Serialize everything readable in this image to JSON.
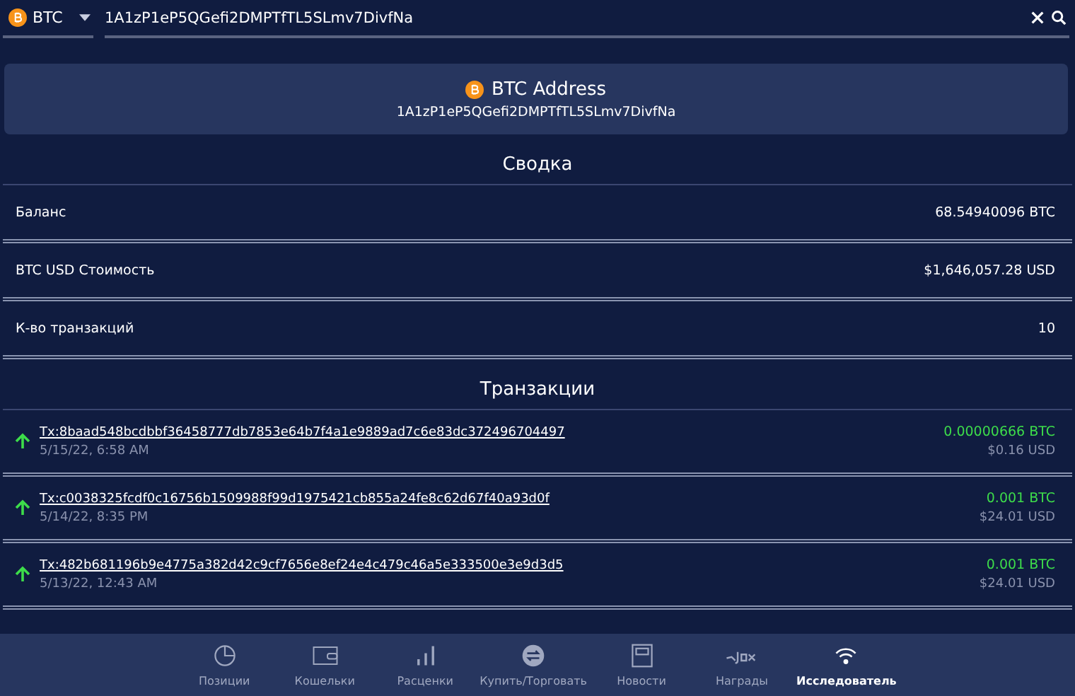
{
  "coin_selector": {
    "symbol": "BTC"
  },
  "search": {
    "value": "1A1zP1eP5QGefi2DMPTfTL5SLmv7DivfNa"
  },
  "address_card": {
    "title": "BTC Address",
    "address": "1A1zP1eP5QGefi2DMPTfTL5SLmv7DivfNa"
  },
  "summary": {
    "title": "Сводка",
    "rows": [
      {
        "label": "Баланс",
        "value": "68.54940096 BTC"
      },
      {
        "label": "BTC USD Стоимость",
        "value": "$1,646,057.28 USD"
      },
      {
        "label": "К-во транзакций",
        "value": "10"
      }
    ]
  },
  "transactions": {
    "title": "Транзакции",
    "items": [
      {
        "hash": "Tx:8baad548bcdbbf36458777db7853e64b7f4a1e9889ad7c6e83dc372496704497",
        "date": "5/15/22, 6:58 AM",
        "amount": "0.00000666 BTC",
        "usd": "$0.16 USD"
      },
      {
        "hash": "Tx:c0038325fcdf0c16756b1509988f99d1975421cb855a24fe8c62d67f40a93d0f",
        "date": "5/14/22, 8:35 PM",
        "amount": "0.001 BTC",
        "usd": "$24.01 USD"
      },
      {
        "hash": "Tx:482b681196b9e4775a382d42c9cf7656e8ef24e4c479c46a5e333500e3e9d3d5",
        "date": "5/13/22, 12:43 AM",
        "amount": "0.001 BTC",
        "usd": "$24.01 USD"
      }
    ]
  },
  "nav": [
    {
      "kind": "pie",
      "label": "Позиции",
      "selected": false
    },
    {
      "kind": "wallet",
      "label": "Кошельки",
      "selected": false
    },
    {
      "kind": "bars",
      "label": "Расценки",
      "selected": false
    },
    {
      "kind": "exchange",
      "label": "Купить/Торговать",
      "selected": false
    },
    {
      "kind": "news",
      "label": "Новости",
      "selected": false
    },
    {
      "kind": "jaxx",
      "label": "Награды",
      "selected": false
    },
    {
      "kind": "explorer",
      "label": "Исследователь",
      "selected": true
    }
  ]
}
